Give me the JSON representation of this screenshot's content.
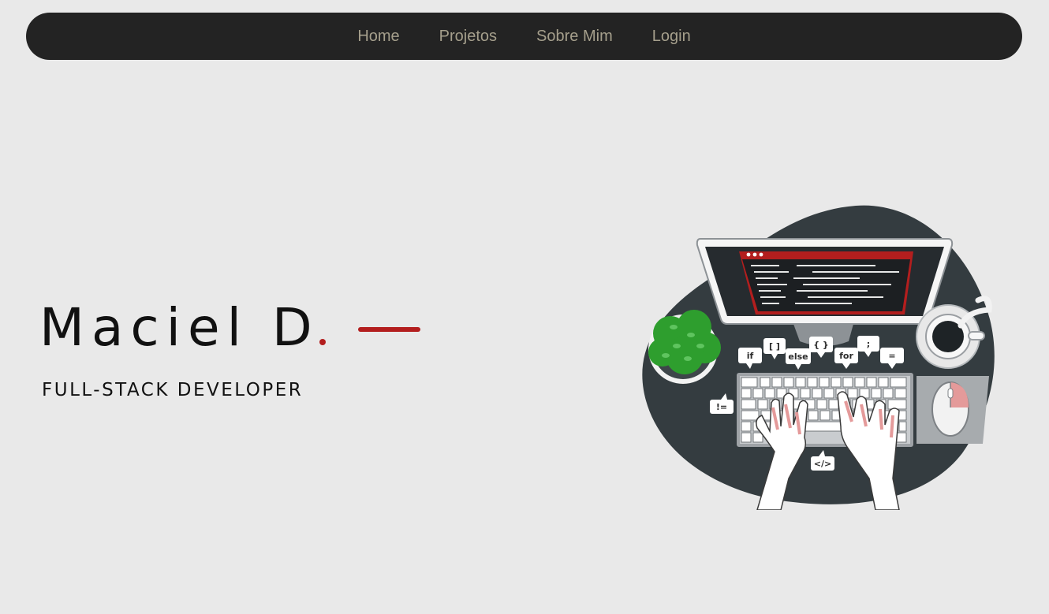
{
  "nav": {
    "items": [
      {
        "label": "Home"
      },
      {
        "label": "Projetos"
      },
      {
        "label": "Sobre Mim"
      },
      {
        "label": "Login"
      }
    ]
  },
  "hero": {
    "name": "Maciel D",
    "role": "FULL-STACK DEVELOPER"
  },
  "illustration": {
    "tokens": [
      "if",
      "[ ]",
      "else",
      "{ }",
      "for",
      ";",
      "=",
      "!=",
      "</>"
    ]
  },
  "colors": {
    "background": "#e9e9e9",
    "navbar": "#232323",
    "nav_text": "#a59f8c",
    "accent": "#b31e1e",
    "text": "#111111"
  }
}
